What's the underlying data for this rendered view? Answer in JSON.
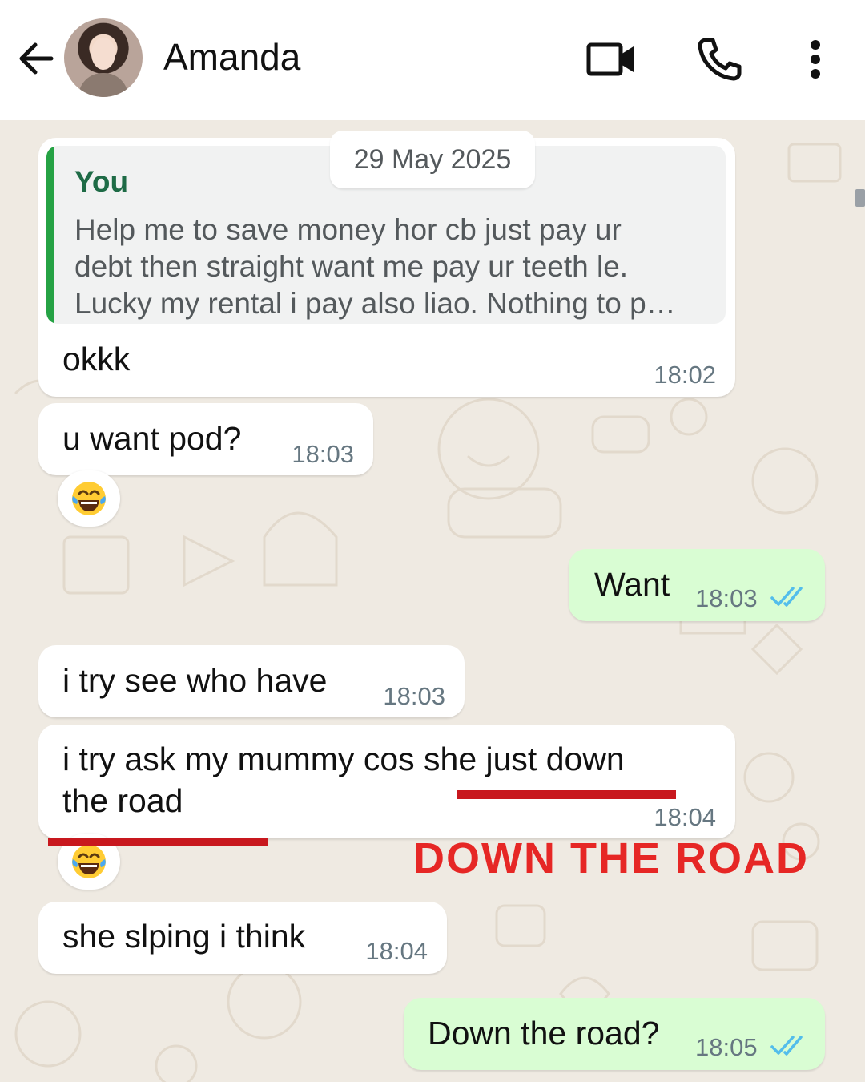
{
  "header": {
    "contact_name": "Amanda",
    "back_icon": "arrow-left-icon",
    "video_icon": "video-camera-icon",
    "call_icon": "phone-icon",
    "menu_icon": "more-vertical-icon"
  },
  "date_separator": "29 May 2025",
  "messages": [
    {
      "direction": "incoming",
      "quote": {
        "author": "You",
        "lines": [
          "Help me to save money hor cb just pay ur",
          "debt then straight want me pay ur teeth le.",
          "Lucky my rental i pay also liao. Nothing to p…"
        ]
      },
      "text": "okkk",
      "time": "18:02"
    },
    {
      "direction": "incoming",
      "text": "u want pod?",
      "time": "18:03",
      "reaction": "😂"
    },
    {
      "direction": "outgoing",
      "text": "Want",
      "time": "18:03",
      "status": "read"
    },
    {
      "direction": "incoming",
      "text": "i try see who have",
      "time": "18:03"
    },
    {
      "direction": "incoming",
      "lines": [
        "i try ask my mummy cos she just down",
        "the road"
      ],
      "time": "18:04",
      "reaction": "😂"
    },
    {
      "direction": "incoming",
      "text": "she slping i think",
      "time": "18:04"
    },
    {
      "direction": "outgoing",
      "text": "Down the road?",
      "time": "18:05",
      "status": "read"
    }
  ],
  "annotation": {
    "text": "Down the road",
    "color": "#e62725"
  },
  "colors": {
    "outgoing_bubble": "#d9fdd3",
    "incoming_bubble": "#ffffff",
    "read_ticks": "#53bdeb",
    "quote_bar": "#25a244",
    "wallpaper": "#efeae2"
  }
}
